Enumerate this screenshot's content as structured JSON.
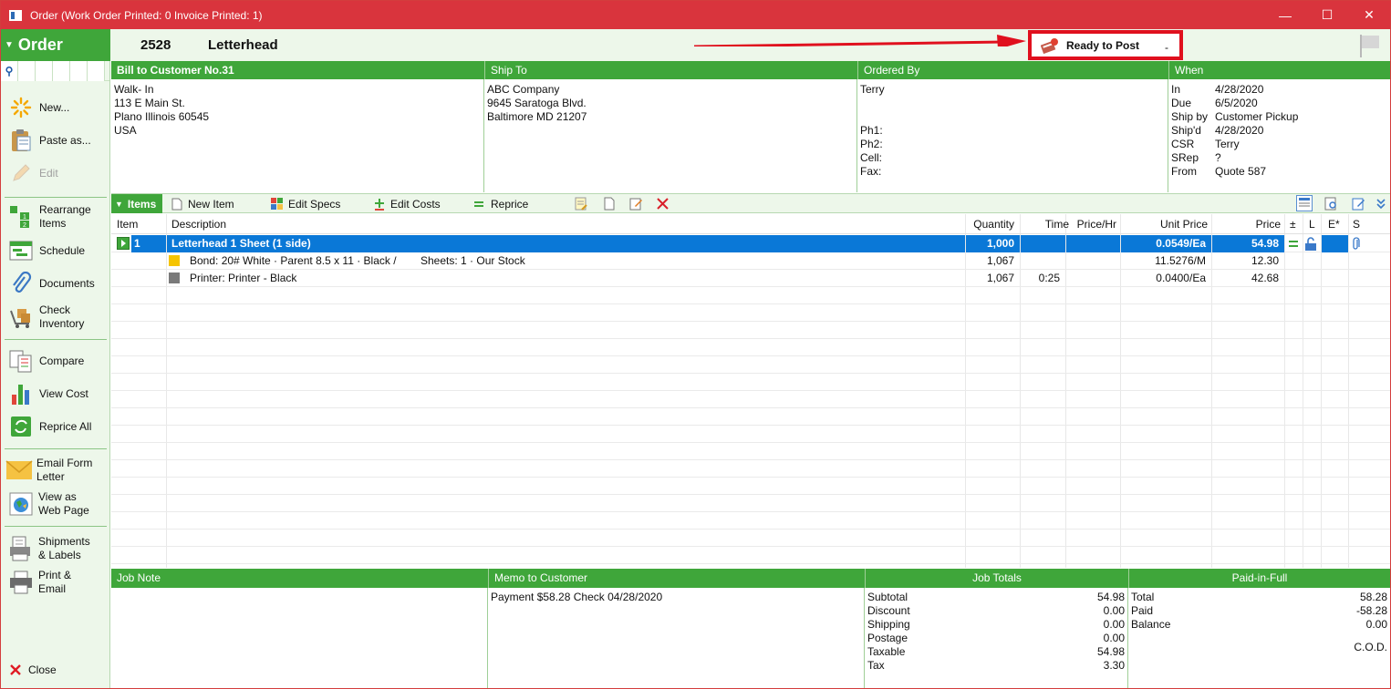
{
  "window": {
    "title": "Order (Work Order Printed: 0  Invoice Printed: 1)",
    "controls": {
      "minimize": "—",
      "maximize": "☐",
      "close": "✕"
    }
  },
  "header": {
    "section_label": "Order",
    "order_number": "2528",
    "order_title": "Letterhead",
    "status": {
      "label": "Ready to Post",
      "dash": "-"
    },
    "annotation_arrow_color": "#e0101e"
  },
  "sidebar": {
    "items": [
      {
        "label": "New...",
        "icon": "new-sun-icon"
      },
      {
        "label": "Paste as...",
        "icon": "clipboard-icon"
      },
      {
        "label": "Edit",
        "icon": "pencil-icon",
        "enabled": false
      },
      {
        "label": "Rearrange Items",
        "icon": "rearrange-icon"
      },
      {
        "label": "Schedule",
        "icon": "calendar-icon"
      },
      {
        "label": "Documents",
        "icon": "paperclip-icon"
      },
      {
        "label": "Check Inventory",
        "icon": "inventory-cart-icon"
      },
      {
        "label": "Compare",
        "icon": "compare-icon"
      },
      {
        "label": "View Cost",
        "icon": "bar-chart-icon"
      },
      {
        "label": "Reprice All",
        "icon": "reprice-icon"
      },
      {
        "label": "Email Form Letter",
        "icon": "envelope-icon"
      },
      {
        "label": "View as Web Page",
        "icon": "globe-icon"
      },
      {
        "label": "Shipments & Labels",
        "icon": "shipments-icon"
      },
      {
        "label": "Print & Email",
        "icon": "printer-icon"
      },
      {
        "label": "Close",
        "icon": "close-x-icon"
      }
    ]
  },
  "bill_to": {
    "heading": "Bill to Customer No.31",
    "lines": [
      "Walk- In",
      "113 E Main St.",
      "Plano Illinois 60545",
      "USA"
    ]
  },
  "ship_to": {
    "heading": "Ship To",
    "lines": [
      "ABC Company",
      "9645 Saratoga Blvd.",
      "Baltimore MD 21207"
    ]
  },
  "ordered_by": {
    "heading": "Ordered By",
    "name": "Terry",
    "phones": [
      "Ph1:",
      "Ph2:",
      "Cell:",
      "Fax:"
    ]
  },
  "when": {
    "heading": "When",
    "rows": [
      {
        "k": "In",
        "v": "4/28/2020"
      },
      {
        "k": "Due",
        "v": "6/5/2020"
      },
      {
        "k": "Ship by",
        "v": "Customer Pickup"
      },
      {
        "k": "Ship'd",
        "v": "4/28/2020"
      },
      {
        "k": "CSR",
        "v": "Terry"
      },
      {
        "k": "SRep",
        "v": "?"
      },
      {
        "k": "From",
        "v": "Quote 587"
      }
    ]
  },
  "items_toolbar": {
    "items_label": "Items",
    "new_item": "New Item",
    "edit_specs": "Edit Specs",
    "edit_costs": "Edit Costs",
    "reprice": "Reprice"
  },
  "grid": {
    "columns": [
      "Item",
      "Description",
      "Quantity",
      "Time",
      "Price/Hr",
      "Unit Price",
      "Price",
      "±",
      "L",
      "E*",
      "S"
    ],
    "rows": [
      {
        "item": "1",
        "description": "Letterhead   1 Sheet (1 side)",
        "quantity": "1,000",
        "time": "",
        "price_hr": "",
        "unit_price": "0.0549/Ea",
        "price": "54.98",
        "selected": true
      },
      {
        "item": "",
        "description": "Bond: 20# White · Parent 8.5 x 11 · Black /",
        "extra": "Sheets: 1 · Our Stock",
        "quantity": "1,067",
        "time": "",
        "price_hr": "",
        "unit_price": "11.5276/M",
        "price": "12.30",
        "swatch": "#f5c400"
      },
      {
        "item": "",
        "description": "Printer: Printer - Black",
        "extra": "",
        "quantity": "1,067",
        "time": "0:25",
        "price_hr": "",
        "unit_price": "0.0400/Ea",
        "price": "42.68",
        "swatch": "#7a7a7a"
      }
    ]
  },
  "job_note": {
    "heading": "Job Note",
    "text": ""
  },
  "memo": {
    "heading": "Memo to Customer",
    "text": "Payment $58.28 Check 04/28/2020"
  },
  "job_totals": {
    "heading": "Job Totals",
    "rows": [
      {
        "k": "Subtotal",
        "v": "54.98"
      },
      {
        "k": "Discount",
        "v": "0.00"
      },
      {
        "k": "Shipping",
        "v": "0.00"
      },
      {
        "k": "Postage",
        "v": "0.00"
      },
      {
        "k": "Taxable",
        "v": "54.98"
      },
      {
        "k": "Tax",
        "v": "3.30"
      }
    ]
  },
  "paid": {
    "heading": "Paid-in-Full",
    "rows": [
      {
        "k": "Total",
        "v": "58.28"
      },
      {
        "k": "Paid",
        "v": "-58.28"
      },
      {
        "k": "Balance",
        "v": "0.00"
      }
    ],
    "terms": "C.O.D."
  },
  "colors": {
    "green": "#3fa63a",
    "title_red": "#d9343d",
    "selection_blue": "#0a78d7"
  }
}
